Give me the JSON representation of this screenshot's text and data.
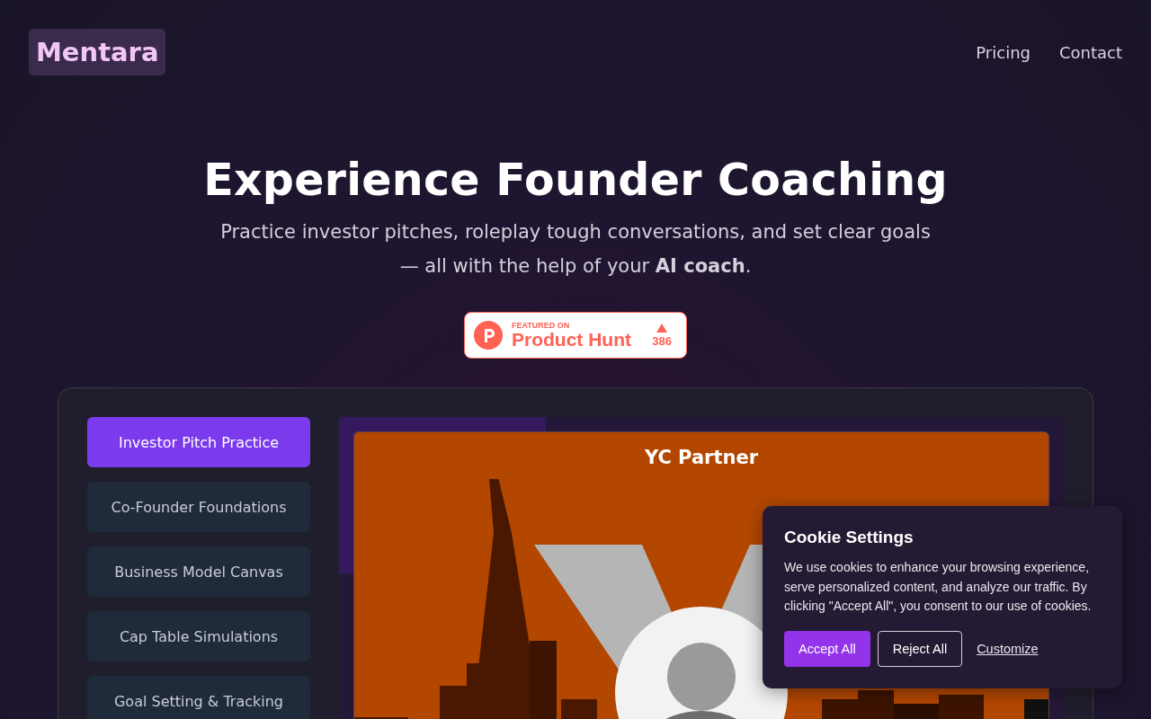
{
  "header": {
    "logo": "Mentara",
    "nav": [
      "Pricing",
      "Contact"
    ]
  },
  "hero": {
    "title": "Experience Founder Coaching",
    "subtitle": "Practice investor pitches, roleplay tough conversations, and set clear goals — all with the help of your **AI coach**."
  },
  "badge": {
    "kicker": "FEATURED ON",
    "name": "Product Hunt",
    "votes": "386"
  },
  "demo": {
    "menu": [
      {
        "label": "Investor Pitch Practice",
        "selected": true
      },
      {
        "label": "Co-Founder Foundations",
        "selected": false
      },
      {
        "label": "Business Model Canvas",
        "selected": false
      },
      {
        "label": "Cap Table Simulations",
        "selected": false
      },
      {
        "label": "Goal Setting & Tracking",
        "selected": false
      }
    ],
    "persona": {
      "title": "YC Partner"
    }
  },
  "cookie": {
    "title": "Cookie Settings",
    "text": "We use cookies to enhance your browsing experience, serve personalized content, and analyze our traffic. By clicking \"Accept All\", you consent to our use of cookies.",
    "buttons": [
      {
        "label": "Accept All",
        "kind": "primary"
      },
      {
        "label": "Reject All",
        "kind": "outline"
      },
      {
        "label": "Customize",
        "kind": "link"
      }
    ]
  }
}
